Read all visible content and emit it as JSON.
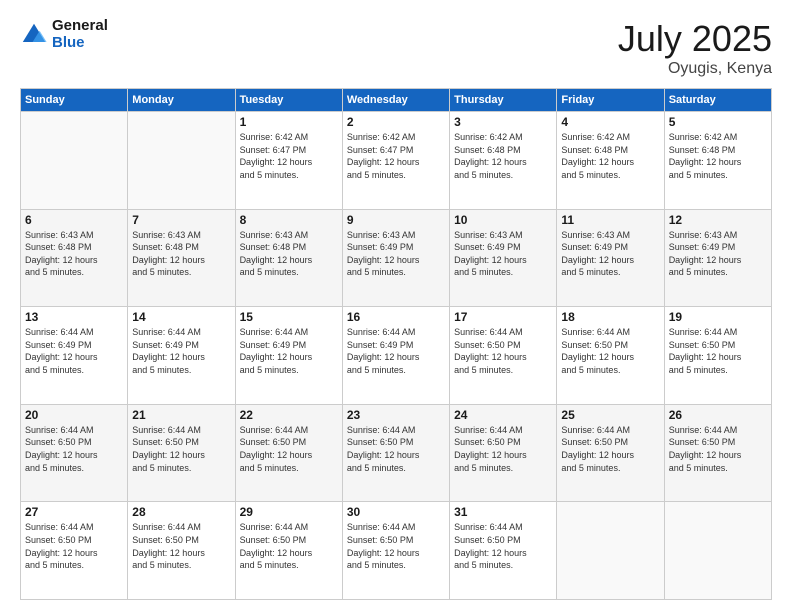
{
  "logo": {
    "line1": "General",
    "line2": "Blue"
  },
  "title": "July 2025",
  "location": "Oyugis, Kenya",
  "days_of_week": [
    "Sunday",
    "Monday",
    "Tuesday",
    "Wednesday",
    "Thursday",
    "Friday",
    "Saturday"
  ],
  "weeks": [
    [
      {
        "day": "",
        "detail": ""
      },
      {
        "day": "",
        "detail": ""
      },
      {
        "day": "1",
        "detail": "Sunrise: 6:42 AM\nSunset: 6:47 PM\nDaylight: 12 hours\nand 5 minutes."
      },
      {
        "day": "2",
        "detail": "Sunrise: 6:42 AM\nSunset: 6:47 PM\nDaylight: 12 hours\nand 5 minutes."
      },
      {
        "day": "3",
        "detail": "Sunrise: 6:42 AM\nSunset: 6:48 PM\nDaylight: 12 hours\nand 5 minutes."
      },
      {
        "day": "4",
        "detail": "Sunrise: 6:42 AM\nSunset: 6:48 PM\nDaylight: 12 hours\nand 5 minutes."
      },
      {
        "day": "5",
        "detail": "Sunrise: 6:42 AM\nSunset: 6:48 PM\nDaylight: 12 hours\nand 5 minutes."
      }
    ],
    [
      {
        "day": "6",
        "detail": "Sunrise: 6:43 AM\nSunset: 6:48 PM\nDaylight: 12 hours\nand 5 minutes."
      },
      {
        "day": "7",
        "detail": "Sunrise: 6:43 AM\nSunset: 6:48 PM\nDaylight: 12 hours\nand 5 minutes."
      },
      {
        "day": "8",
        "detail": "Sunrise: 6:43 AM\nSunset: 6:48 PM\nDaylight: 12 hours\nand 5 minutes."
      },
      {
        "day": "9",
        "detail": "Sunrise: 6:43 AM\nSunset: 6:49 PM\nDaylight: 12 hours\nand 5 minutes."
      },
      {
        "day": "10",
        "detail": "Sunrise: 6:43 AM\nSunset: 6:49 PM\nDaylight: 12 hours\nand 5 minutes."
      },
      {
        "day": "11",
        "detail": "Sunrise: 6:43 AM\nSunset: 6:49 PM\nDaylight: 12 hours\nand 5 minutes."
      },
      {
        "day": "12",
        "detail": "Sunrise: 6:43 AM\nSunset: 6:49 PM\nDaylight: 12 hours\nand 5 minutes."
      }
    ],
    [
      {
        "day": "13",
        "detail": "Sunrise: 6:44 AM\nSunset: 6:49 PM\nDaylight: 12 hours\nand 5 minutes."
      },
      {
        "day": "14",
        "detail": "Sunrise: 6:44 AM\nSunset: 6:49 PM\nDaylight: 12 hours\nand 5 minutes."
      },
      {
        "day": "15",
        "detail": "Sunrise: 6:44 AM\nSunset: 6:49 PM\nDaylight: 12 hours\nand 5 minutes."
      },
      {
        "day": "16",
        "detail": "Sunrise: 6:44 AM\nSunset: 6:49 PM\nDaylight: 12 hours\nand 5 minutes."
      },
      {
        "day": "17",
        "detail": "Sunrise: 6:44 AM\nSunset: 6:50 PM\nDaylight: 12 hours\nand 5 minutes."
      },
      {
        "day": "18",
        "detail": "Sunrise: 6:44 AM\nSunset: 6:50 PM\nDaylight: 12 hours\nand 5 minutes."
      },
      {
        "day": "19",
        "detail": "Sunrise: 6:44 AM\nSunset: 6:50 PM\nDaylight: 12 hours\nand 5 minutes."
      }
    ],
    [
      {
        "day": "20",
        "detail": "Sunrise: 6:44 AM\nSunset: 6:50 PM\nDaylight: 12 hours\nand 5 minutes."
      },
      {
        "day": "21",
        "detail": "Sunrise: 6:44 AM\nSunset: 6:50 PM\nDaylight: 12 hours\nand 5 minutes."
      },
      {
        "day": "22",
        "detail": "Sunrise: 6:44 AM\nSunset: 6:50 PM\nDaylight: 12 hours\nand 5 minutes."
      },
      {
        "day": "23",
        "detail": "Sunrise: 6:44 AM\nSunset: 6:50 PM\nDaylight: 12 hours\nand 5 minutes."
      },
      {
        "day": "24",
        "detail": "Sunrise: 6:44 AM\nSunset: 6:50 PM\nDaylight: 12 hours\nand 5 minutes."
      },
      {
        "day": "25",
        "detail": "Sunrise: 6:44 AM\nSunset: 6:50 PM\nDaylight: 12 hours\nand 5 minutes."
      },
      {
        "day": "26",
        "detail": "Sunrise: 6:44 AM\nSunset: 6:50 PM\nDaylight: 12 hours\nand 5 minutes."
      }
    ],
    [
      {
        "day": "27",
        "detail": "Sunrise: 6:44 AM\nSunset: 6:50 PM\nDaylight: 12 hours\nand 5 minutes."
      },
      {
        "day": "28",
        "detail": "Sunrise: 6:44 AM\nSunset: 6:50 PM\nDaylight: 12 hours\nand 5 minutes."
      },
      {
        "day": "29",
        "detail": "Sunrise: 6:44 AM\nSunset: 6:50 PM\nDaylight: 12 hours\nand 5 minutes."
      },
      {
        "day": "30",
        "detail": "Sunrise: 6:44 AM\nSunset: 6:50 PM\nDaylight: 12 hours\nand 5 minutes."
      },
      {
        "day": "31",
        "detail": "Sunrise: 6:44 AM\nSunset: 6:50 PM\nDaylight: 12 hours\nand 5 minutes."
      },
      {
        "day": "",
        "detail": ""
      },
      {
        "day": "",
        "detail": ""
      }
    ]
  ]
}
